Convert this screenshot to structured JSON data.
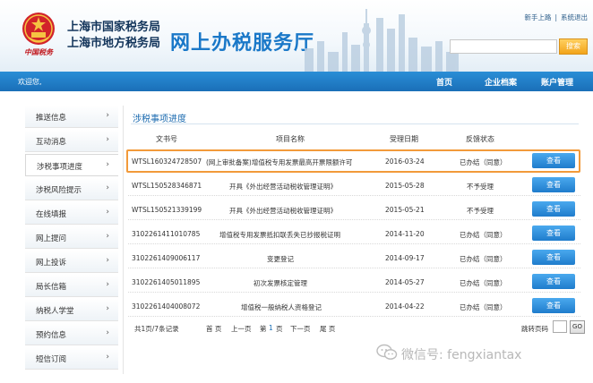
{
  "header": {
    "emblem_caption": "中国税务",
    "bureau_line1": "上海市国家税务局",
    "bureau_line2": "上海市地方税务局",
    "site_title": "网上办税服务厅",
    "top_links": [
      "新手上路",
      "|",
      "系统退出"
    ],
    "search_placeholder": "",
    "search_button": "搜索"
  },
  "navbar": {
    "welcome": "欢迎您,",
    "items": [
      "首页",
      "企业档案",
      "账户管理"
    ]
  },
  "sidebar": {
    "arrow": "›",
    "items": [
      {
        "label": "推送信息",
        "active": false
      },
      {
        "label": "互动消息",
        "active": false
      },
      {
        "label": "涉税事项进度",
        "active": true
      },
      {
        "label": "涉税风险提示",
        "active": false
      },
      {
        "label": "在线填报",
        "active": false
      },
      {
        "label": "网上提问",
        "active": false
      },
      {
        "label": "网上投诉",
        "active": false
      },
      {
        "label": "局长信箱",
        "active": false
      },
      {
        "label": "纳税人学堂",
        "active": false
      },
      {
        "label": "预约信息",
        "active": false
      },
      {
        "label": "短信订阅",
        "active": false
      }
    ]
  },
  "main": {
    "title": "涉税事项进度",
    "columns": [
      "文书号",
      "项目名称",
      "受理日期",
      "反馈状态"
    ],
    "view_label": "查看",
    "rows": [
      {
        "doc_no": "WTSL160324728507",
        "project": "(网上审批备案)增值税专用发票最高开票限额许可",
        "date": "2016-03-24",
        "status": "已办结（同意）",
        "highlighted": true
      },
      {
        "doc_no": "WTSL150528346871",
        "project": "开具《外出经营活动税收管理证明》",
        "date": "2015-05-28",
        "status": "不予受理",
        "highlighted": false
      },
      {
        "doc_no": "WTSL150521339199",
        "project": "开具《外出经营活动税收管理证明》",
        "date": "2015-05-21",
        "status": "不予受理",
        "highlighted": false
      },
      {
        "doc_no": "3102261411010785",
        "project": "增值税专用发票抵扣联丢失已抄报税证明",
        "date": "2014-11-20",
        "status": "已办结（同意）",
        "highlighted": false
      },
      {
        "doc_no": "3102261409006117",
        "project": "变更登记",
        "date": "2014-09-17",
        "status": "已办结（同意）",
        "highlighted": false
      },
      {
        "doc_no": "3102261405011895",
        "project": "初次发票核定管理",
        "date": "2014-05-27",
        "status": "已办结（同意）",
        "highlighted": false
      },
      {
        "doc_no": "3102261404008072",
        "project": "增值税一般纳税人资格登记",
        "date": "2014-04-22",
        "status": "已办结（同意）",
        "highlighted": false
      }
    ],
    "pager": {
      "summary": "共1页/7条记录",
      "first": "首 页",
      "prev": "上一页",
      "page_prefix": "第",
      "current_page": "1",
      "page_suffix": "页",
      "next": "下一页",
      "last": "尾 页",
      "jump_label": "跳转页码",
      "jump_value": "",
      "go_label": "GO"
    }
  },
  "watermark": {
    "text": "微信号: fengxiantax"
  }
}
